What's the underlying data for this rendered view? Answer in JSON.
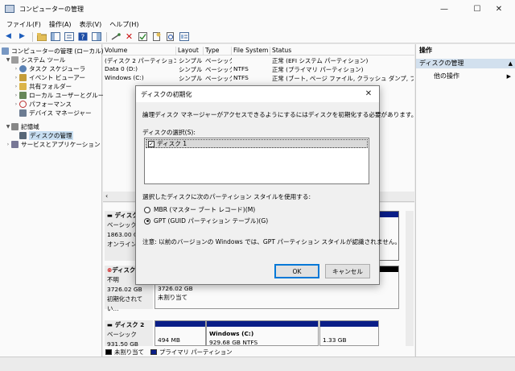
{
  "window": {
    "title": "コンピューターの管理",
    "controls": [
      "—",
      "☐",
      "✕"
    ]
  },
  "menu": [
    "ファイル(F)",
    "操作(A)",
    "表示(V)",
    "ヘルプ(H)"
  ],
  "tree": {
    "root": "コンピューターの管理 (ローカル)",
    "system_tools": "システム ツール",
    "task_scheduler": "タスク スケジューラ",
    "event_viewer": "イベント ビューアー",
    "shared_folders": "共有フォルダー",
    "local_users": "ローカル ユーザーとグループ",
    "performance": "パフォーマンス",
    "device_manager": "デバイス マネージャー",
    "storage": "記憶域",
    "disk_management": "ディスクの管理",
    "services_apps": "サービスとアプリケーション"
  },
  "volume_table": {
    "headers": [
      "Volume",
      "Layout",
      "Type",
      "File System",
      "Status"
    ],
    "rows": [
      {
        "volume": "(ディスク 2 パーティション 1)",
        "layout": "シンプル",
        "type": "ベーシック",
        "fs": "",
        "status": "正常 (EFI システム パーティション)"
      },
      {
        "volume": "Data 0 (D:)",
        "layout": "シンプル",
        "type": "ベーシック",
        "fs": "NTFS",
        "status": "正常 (プライマリ パーティション)"
      },
      {
        "volume": "Windows (C:)",
        "layout": "シンプル",
        "type": "ベーシック",
        "fs": "NTFS",
        "status": "正常 (ブート, ページ ファイル, クラッシュ ダンプ, プライマリ パー"
      }
    ]
  },
  "disks": {
    "disk_a": {
      "name": "ディスク",
      "type": "ベーシック",
      "size": "1863.00 G",
      "state": "オンライン"
    },
    "disk_b": {
      "name": "ディスク",
      "type": "不明",
      "size": "3726.02 GB",
      "state": "初期化されてい..."
    },
    "disk_b_part": {
      "size": "3726.02 GB",
      "label": "未割り当て"
    },
    "disk_2": {
      "name": "ディスク 2",
      "type": "ベーシック",
      "size": "931.50 GB"
    },
    "disk_2_parts": [
      {
        "size": "494 MB"
      },
      {
        "name": "Windows  (C:)",
        "size": "929.68 GB NTFS"
      },
      {
        "size": "1.33 GB"
      }
    ]
  },
  "legend": {
    "unallocated": "未割り当て",
    "primary": "プライマリ パーティション"
  },
  "actions": {
    "header": "操作",
    "section": "ディスクの管理",
    "more": "他の操作"
  },
  "dialog": {
    "title": "ディスクの初期化",
    "intro": "論理ディスク マネージャーがアクセスできるようにするにはディスクを初期化する必要があります。",
    "select_label": "ディスクの選択(S):",
    "disk_item": "ディスク 1",
    "style_label": "選択したディスクに次のパーティション スタイルを使用する:",
    "mbr": "MBR (マスター ブート レコード)(M)",
    "gpt": "GPT (GUID パーティション テーブル)(G)",
    "note": "注意: 以前のバージョンの Windows では、GPT パーティション スタイルが認識されません。",
    "ok": "OK",
    "cancel": "キャンセル"
  },
  "colors": {
    "primary_partition": "#0b1f8a",
    "unallocated": "#000000",
    "selection": "#cce4f7"
  }
}
